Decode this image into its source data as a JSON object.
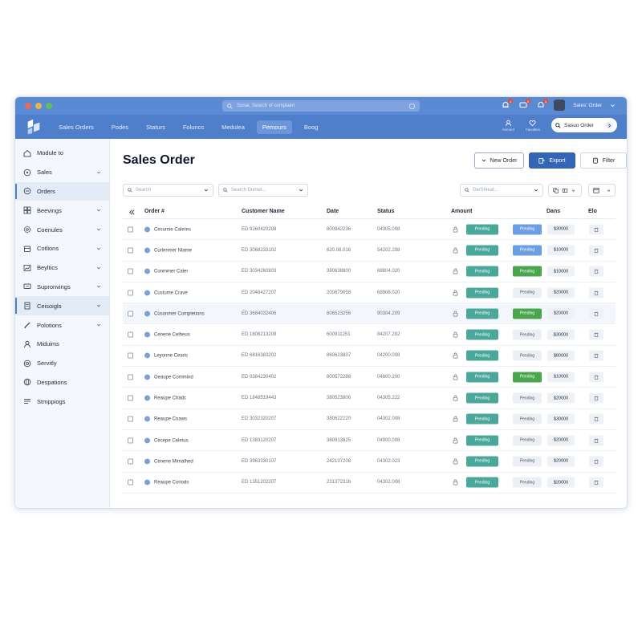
{
  "titlebar": {
    "search_placeholder": "Sonar, Search of complaint",
    "user_name": "Sales' Order",
    "badges": [
      "4",
      "5",
      "5"
    ]
  },
  "navbar": {
    "items": [
      "Sales Orders",
      "Podes",
      "Staturs",
      "Foluncs",
      "Medulea",
      "Pemours",
      "Boog"
    ],
    "active_index": 5,
    "icon_labels": [
      "Amount",
      "Faculties"
    ],
    "cta_label": "Sasuo Order"
  },
  "sidebar": {
    "items": [
      {
        "label": "Module to",
        "icon": "home-icon",
        "chevron": false
      },
      {
        "label": "Sales",
        "icon": "tag-icon",
        "chevron": true
      },
      {
        "label": "Orders",
        "icon": "orders-icon",
        "chevron": false,
        "active": true
      },
      {
        "label": "Beevings",
        "icon": "grid-icon",
        "chevron": true
      },
      {
        "label": "Coenules",
        "icon": "gear-icon",
        "chevron": true
      },
      {
        "label": "Cotlions",
        "icon": "box-icon",
        "chevron": true
      },
      {
        "label": "Beyltics",
        "icon": "chart-icon",
        "chevron": true
      },
      {
        "label": "Supronvings",
        "icon": "message-icon",
        "chevron": true
      },
      {
        "label": "Ceisoigls",
        "icon": "document-icon",
        "chevron": true,
        "active": true
      },
      {
        "label": "Polotions",
        "icon": "pen-icon",
        "chevron": true
      },
      {
        "label": "Miduims",
        "icon": "user-icon",
        "chevron": false
      },
      {
        "label": "Servitly",
        "icon": "settings-icon",
        "chevron": false
      },
      {
        "label": "Despations",
        "icon": "globe-icon",
        "chevron": false
      },
      {
        "label": "Stmppiogs",
        "icon": "stack-icon",
        "chevron": false
      }
    ]
  },
  "main": {
    "title": "Sales Order",
    "buttons": {
      "new_order": "New Order",
      "export": "Export",
      "filter": "Filter"
    },
    "filters": {
      "search": "Search",
      "search_2": "Search Dumet...",
      "right_search": "Oe/Shleat..."
    },
    "columns": {
      "order": "Order #",
      "customer": "Customer Name",
      "date": "Date",
      "status": "Status",
      "amount": "Amount",
      "dans": "Dans",
      "elo": "Elo"
    }
  },
  "rows": [
    {
      "name": "Cesumie Caleres",
      "customer": "ED 9260420208",
      "date": "800942236",
      "status": "04305.008",
      "status_label": "Pending",
      "status_color": "blue",
      "amount": "$30000",
      "highlight": false
    },
    {
      "name": "Curlenmer Nlame",
      "customer": "ED 3068233102",
      "date": "620.08.016",
      "status": "54202.208",
      "status_label": "Pending",
      "status_color": "blue",
      "amount": "$10000",
      "highlight": false
    },
    {
      "name": "Conmmer Caler",
      "customer": "ED 3034260803",
      "date": "380638800",
      "status": "68804.020",
      "status_label": "Pending",
      "status_color": "green",
      "amount": "$10000",
      "highlight": false
    },
    {
      "name": "Custume Crave",
      "customer": "ED 2048427207",
      "date": "200679058",
      "status": "68906.020",
      "status_label": "Pending",
      "status_color": "gray",
      "amount": "$20000",
      "highlight": false
    },
    {
      "name": "Cusonmer Completions",
      "customer": "ED 3684032406",
      "date": "806523256",
      "status": "90304.209",
      "status_label": "Pending",
      "status_color": "green",
      "amount": "$20000",
      "highlight": true
    },
    {
      "name": "Cenene Celheus",
      "customer": "ED 1808213208",
      "date": "600911251",
      "status": "84207.282",
      "status_label": "Pending",
      "status_color": "gray",
      "amount": "$30000",
      "highlight": false
    },
    {
      "name": "Leyonne Cearis",
      "customer": "ED 6816383202",
      "date": "860623837",
      "status": "04200.008",
      "status_label": "Pending",
      "status_color": "gray",
      "amount": "$80000",
      "highlight": false
    },
    {
      "name": "Geaupe Commind",
      "customer": "ED 0384230402",
      "date": "800572288",
      "status": "04800.200",
      "status_label": "Pending",
      "status_color": "green",
      "amount": "$10000",
      "highlight": false
    },
    {
      "name": "Reaupe Chadc",
      "customer": "ED 1848519443",
      "date": "380523806",
      "status": "04305.222",
      "status_label": "Pending",
      "status_color": "gray",
      "amount": "$20000",
      "highlight": false
    },
    {
      "name": "Reaupe Cnaws",
      "customer": "ED 3032320207",
      "date": "380622220",
      "status": "04302.008",
      "status_label": "Pending",
      "status_color": "gray",
      "amount": "$30000",
      "highlight": false
    },
    {
      "name": "Cecepe Celetus",
      "customer": "ED 1383120207",
      "date": "380913825",
      "status": "04900.008",
      "status_label": "Pending",
      "status_color": "gray",
      "amount": "$20000",
      "highlight": false
    },
    {
      "name": "Cenene Mimalhed",
      "customer": "ED 3963330107",
      "date": "242137208",
      "status": "04302.023",
      "status_label": "Pending",
      "status_color": "gray",
      "amount": "$20000",
      "highlight": false
    },
    {
      "name": "Reaupe Coriods",
      "customer": "ED 1351202207",
      "date": "231372316",
      "status": "04302.008",
      "status_label": "Pending",
      "status_color": "gray",
      "amount": "$20000",
      "highlight": false
    }
  ],
  "amount_label": "Pending",
  "colors": {
    "titlebar": "#5b8ad4",
    "navbar": "#4f7fcb",
    "primary": "#3466b8",
    "teal": "#49a89a",
    "blue_pill": "#6c9fe1",
    "green_pill": "#4aa64d"
  }
}
